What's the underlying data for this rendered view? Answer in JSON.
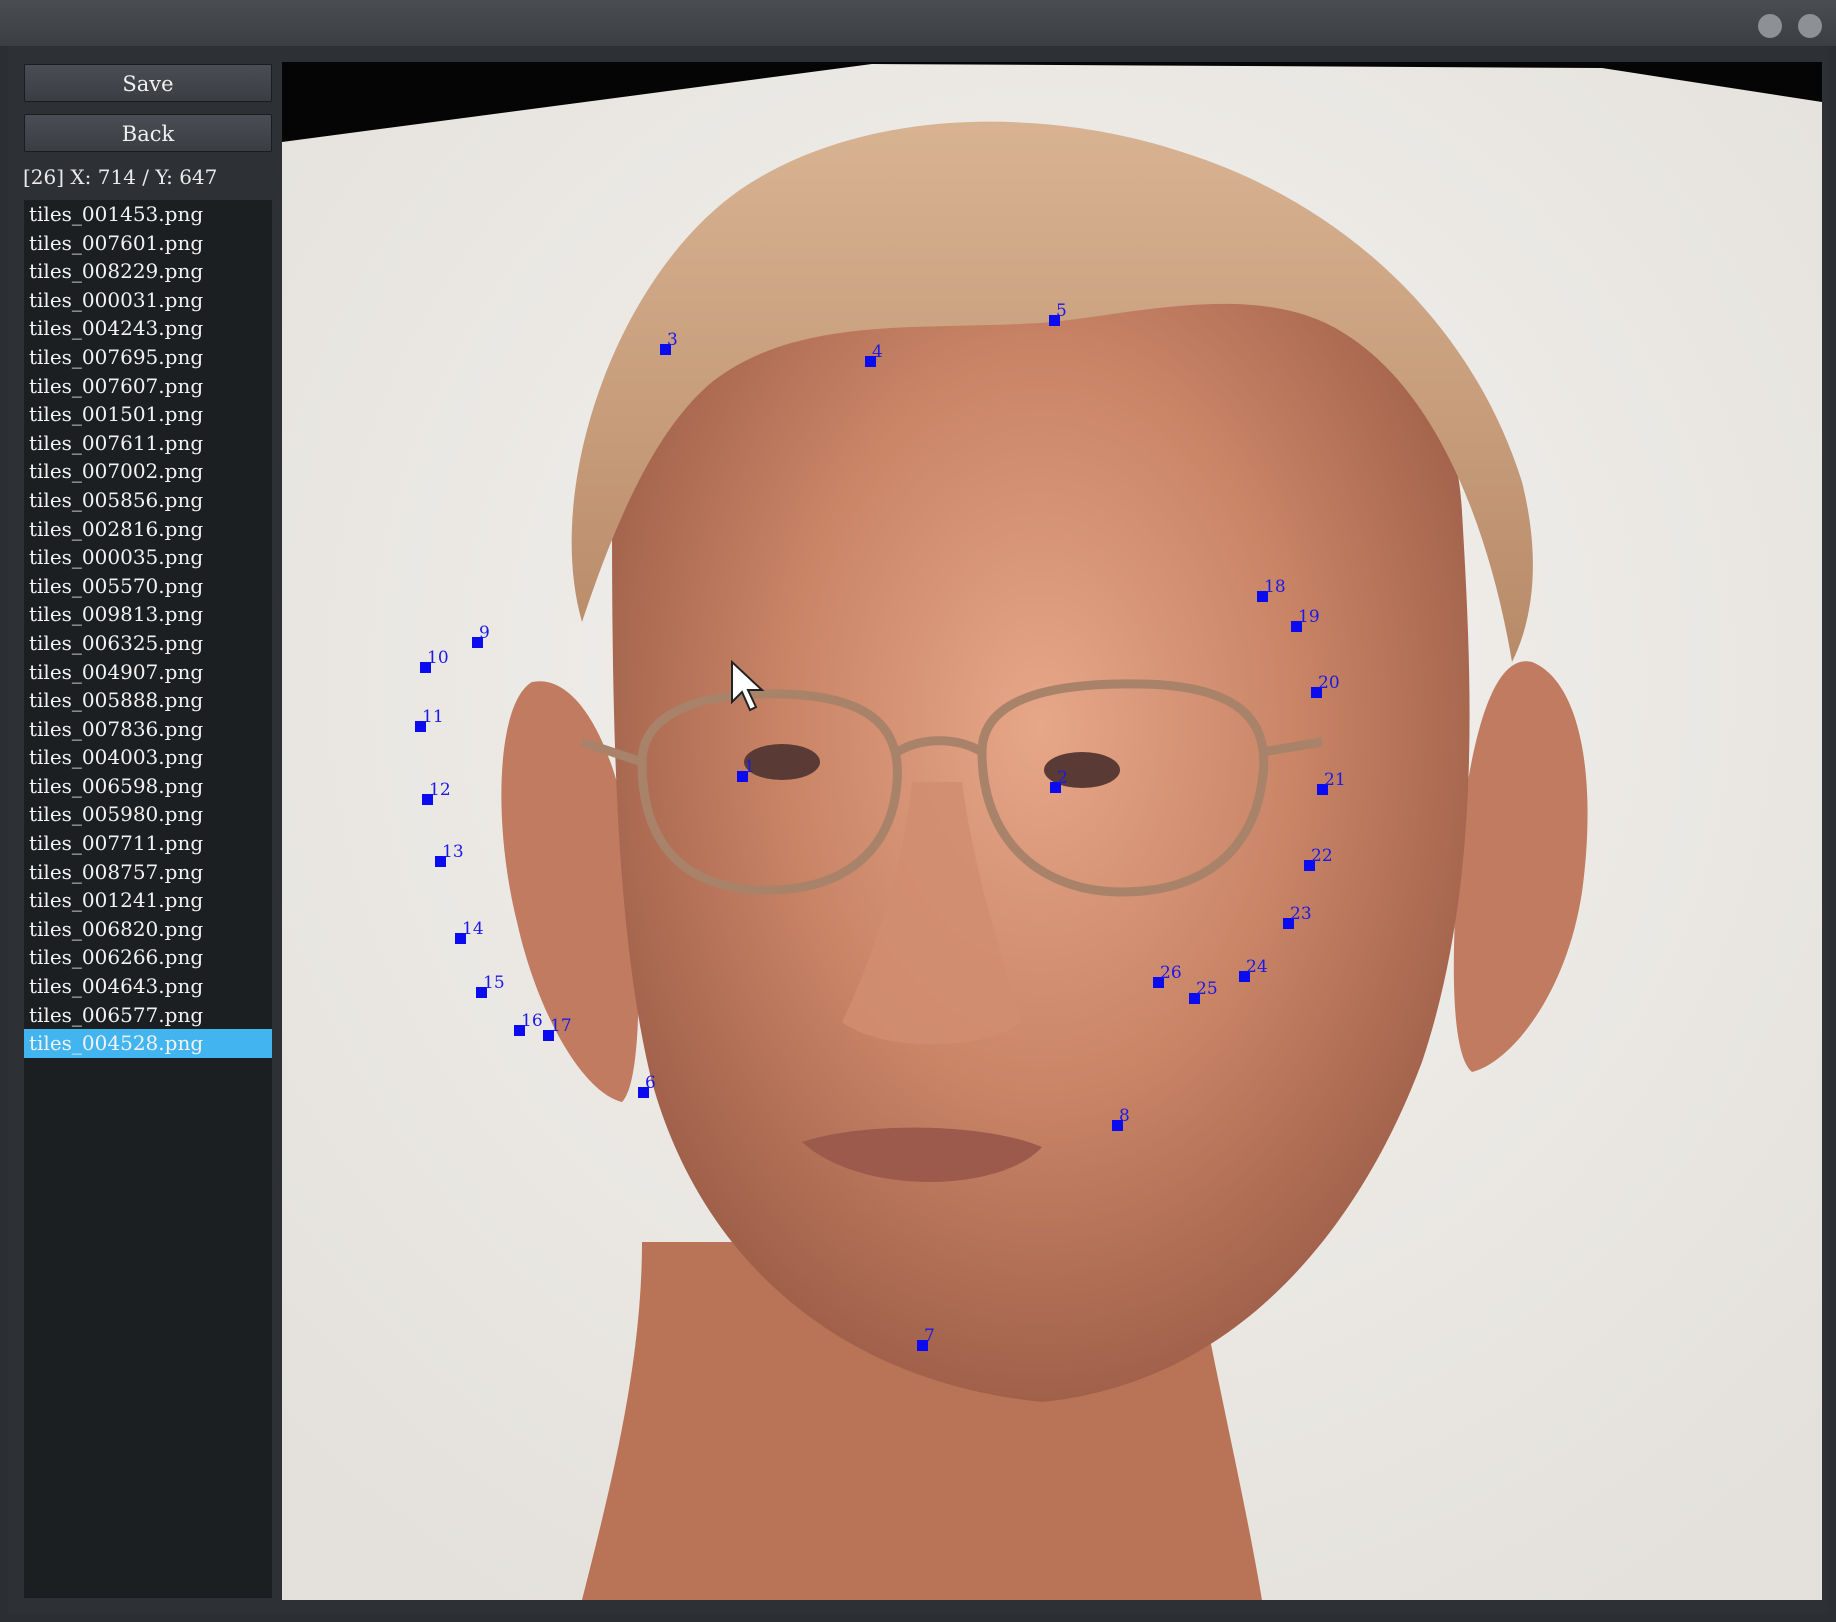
{
  "toolbar": {
    "save_label": "Save",
    "back_label": "Back"
  },
  "status": {
    "coords": "[26] X: 714 / Y: 647"
  },
  "files": [
    "tiles_001453.png",
    "tiles_007601.png",
    "tiles_008229.png",
    "tiles_000031.png",
    "tiles_004243.png",
    "tiles_007695.png",
    "tiles_007607.png",
    "tiles_001501.png",
    "tiles_007611.png",
    "tiles_007002.png",
    "tiles_005856.png",
    "tiles_002816.png",
    "tiles_000035.png",
    "tiles_005570.png",
    "tiles_009813.png",
    "tiles_006325.png",
    "tiles_004907.png",
    "tiles_005888.png",
    "tiles_007836.png",
    "tiles_004003.png",
    "tiles_006598.png",
    "tiles_005980.png",
    "tiles_007711.png",
    "tiles_008757.png",
    "tiles_001241.png",
    "tiles_006820.png",
    "tiles_006266.png",
    "tiles_004643.png",
    "tiles_006577.png",
    "tiles_004528.png"
  ],
  "selected_file_index": 29,
  "landmarks": {
    "labels": [
      "1",
      "2",
      "3",
      "4",
      "5",
      "6",
      "7",
      "8",
      "9",
      "10",
      "11",
      "12",
      "13",
      "14",
      "15",
      "16",
      "17",
      "18",
      "19",
      "20",
      "21",
      "22",
      "23",
      "24",
      "25",
      "26"
    ],
    "color": "#0b0bf0"
  },
  "colors": {
    "accent": "#42b4ef",
    "panel": "#1c1f22",
    "background": "#2d3035"
  },
  "icons": {
    "cursor": "mouse-pointer-icon"
  }
}
